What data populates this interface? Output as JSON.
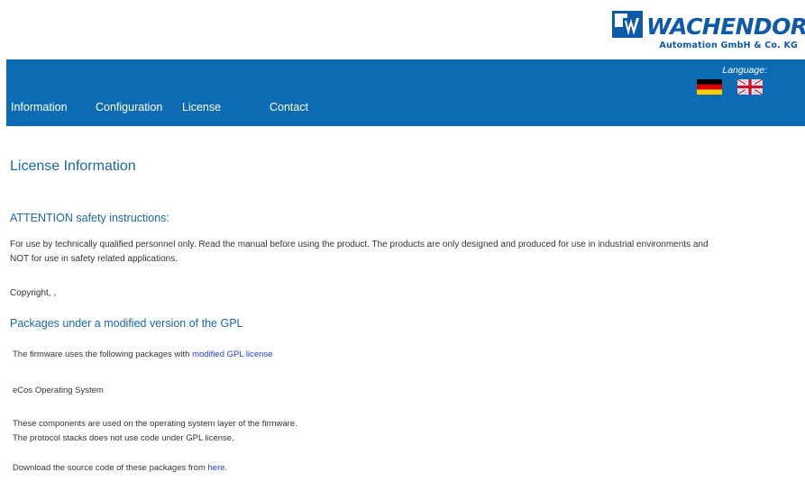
{
  "brand": {
    "name": "WACHENDORFF",
    "subtitle": "Automation GmbH & Co. KG",
    "color": "#0f5aa8"
  },
  "nav": {
    "background": "#0d6bb3",
    "items": [
      {
        "label": "Information"
      },
      {
        "label": "Configuration"
      },
      {
        "label": "License"
      },
      {
        "label": "Contact"
      }
    ],
    "language_label": "Language:",
    "flags": [
      {
        "icon": "german-flag-icon"
      },
      {
        "icon": "uk-flag-icon"
      }
    ]
  },
  "page": {
    "title": "License Information",
    "attention_heading": "ATTENTION safety instructions:",
    "attention_text": "For use by technically qualified personnel only. Read the manual before using the product. The products are only designed and produced for use in industrial environments and NOT for use in safety related applications.",
    "copyright": "Copyright,  ,",
    "gpl_heading": "Packages under a modified version of the GPL",
    "gpl_intro": "The firmware uses the following packages with ",
    "gpl_link": "modified GPL license",
    "package_name": "eCos Operating System",
    "components_line1": "These components are used on the operating system layer of the firmware.",
    "components_line2": "The protocol stacks does not use code under GPL license.",
    "download_text": "Download the source code of these packages from ",
    "download_link": "here",
    "download_suffix": "."
  }
}
